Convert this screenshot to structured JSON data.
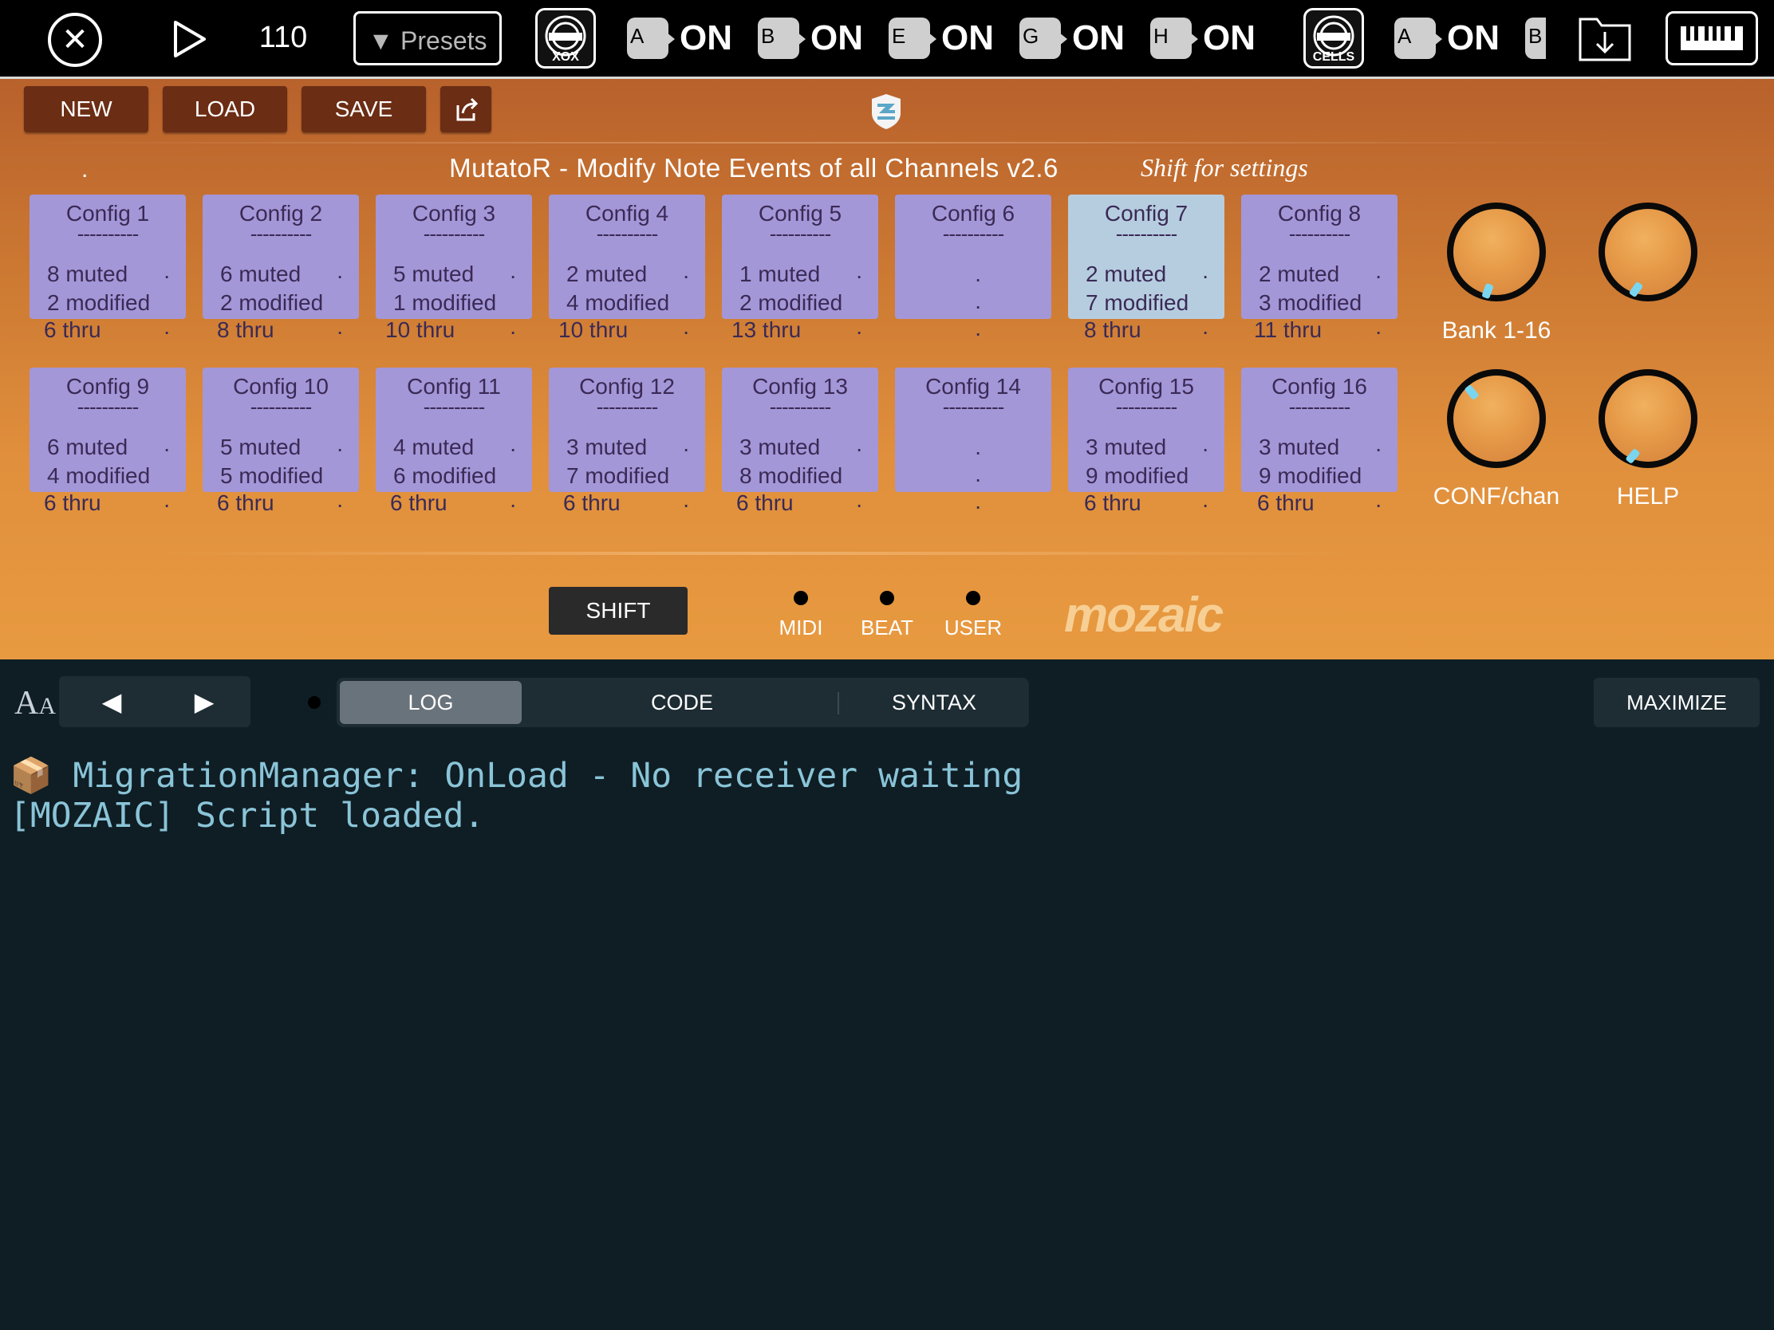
{
  "topbar": {
    "tempo": "110",
    "presets_label": "Presets",
    "apps": [
      {
        "label": "XOX"
      },
      {
        "label": "CELLS"
      }
    ],
    "routes": [
      {
        "letter": "A",
        "state": "ON"
      },
      {
        "letter": "B",
        "state": "ON"
      },
      {
        "letter": "E",
        "state": "ON"
      },
      {
        "letter": "G",
        "state": "ON"
      },
      {
        "letter": "H",
        "state": "ON"
      },
      {
        "letter": "A",
        "state": "ON"
      },
      {
        "letter": "B",
        "state": ""
      }
    ]
  },
  "toolbar": {
    "new_label": "NEW",
    "load_label": "LOAD",
    "save_label": "SAVE"
  },
  "header": {
    "dot": ".",
    "title": "MutatoR -  Modify Note Events of all Channels  v2.6",
    "shift_hint": "Shift for settings"
  },
  "configs": [
    {
      "name": "Config 1",
      "dash": "----------",
      "l1": "8 muted",
      "l2": "2 modified",
      "l3": "6 thru",
      "selected": false
    },
    {
      "name": "Config 2",
      "dash": "----------",
      "l1": "6 muted",
      "l2": "2 modified",
      "l3": "8 thru",
      "selected": false
    },
    {
      "name": "Config 3",
      "dash": "----------",
      "l1": "5 muted",
      "l2": "1 modified",
      "l3": "10 thru",
      "selected": false
    },
    {
      "name": "Config 4",
      "dash": "----------",
      "l1": "2 muted",
      "l2": "4 modified",
      "l3": "10 thru",
      "selected": false
    },
    {
      "name": "Config 5",
      "dash": "----------",
      "l1": "1 muted",
      "l2": "2 modified",
      "l3": "13 thru",
      "selected": false
    },
    {
      "name": "Config 6",
      "dash": "----------",
      "l1": "",
      "l2": "",
      "l3": "",
      "selected": false
    },
    {
      "name": "Config 7",
      "dash": "----------",
      "l1": "2 muted",
      "l2": "7 modified",
      "l3": "8 thru",
      "selected": true
    },
    {
      "name": "Config 8",
      "dash": "----------",
      "l1": "2 muted",
      "l2": "3 modified",
      "l3": "11 thru",
      "selected": false
    },
    {
      "name": "Config 9",
      "dash": "----------",
      "l1": "6 muted",
      "l2": "4 modified",
      "l3": "6 thru",
      "selected": false
    },
    {
      "name": "Config 10",
      "dash": "----------",
      "l1": "5 muted",
      "l2": "5 modified",
      "l3": "6 thru",
      "selected": false
    },
    {
      "name": "Config 11",
      "dash": "----------",
      "l1": "4 muted",
      "l2": "6 modified",
      "l3": "6 thru",
      "selected": false
    },
    {
      "name": "Config 12",
      "dash": "----------",
      "l1": "3 muted",
      "l2": "7 modified",
      "l3": "6 thru",
      "selected": false
    },
    {
      "name": "Config 13",
      "dash": "----------",
      "l1": "3 muted",
      "l2": "8 modified",
      "l3": "6 thru",
      "selected": false
    },
    {
      "name": "Config 14",
      "dash": "----------",
      "l1": "",
      "l2": "",
      "l3": "",
      "selected": false
    },
    {
      "name": "Config 15",
      "dash": "----------",
      "l1": "3 muted",
      "l2": "9 modified",
      "l3": "6 thru",
      "selected": false
    },
    {
      "name": "Config 16",
      "dash": "----------",
      "l1": "3 muted",
      "l2": "9 modified",
      "l3": "6 thru",
      "selected": false
    }
  ],
  "knobs": [
    {
      "label": "Bank 1-16"
    },
    {
      "label": ""
    },
    {
      "label": "CONF/chan"
    },
    {
      "label": "HELP"
    }
  ],
  "footer": {
    "shift_label": "SHIFT",
    "leds": [
      "MIDI",
      "BEAT",
      "USER"
    ],
    "brand": "mozaic"
  },
  "log_panel": {
    "tabs": [
      "LOG",
      "CODE",
      "SYNTAX"
    ],
    "active_tab": "LOG",
    "maximize_label": "MAXIMIZE",
    "lines": [
      "📦 MigrationManager: OnLoad - No receiver waiting",
      "[MOZAIC] Script loaded."
    ]
  },
  "colors": {
    "config_pad": "#a497d8",
    "config_pad_selected": "#b6cde0",
    "button_dark": "#6b2d14",
    "knob_indicator": "#7ad6f0",
    "log_text": "#8ac4d8"
  }
}
